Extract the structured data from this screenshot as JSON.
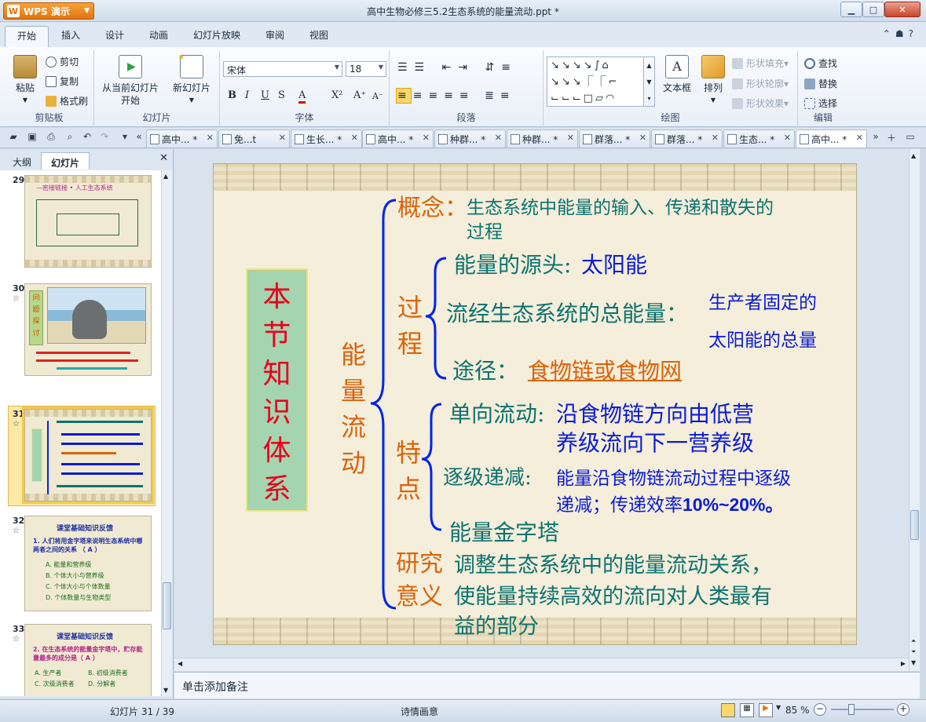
{
  "app": {
    "name": "WPS 演示",
    "window_title": "高中生物必修三5.2生态系统的能量流动.ppt *"
  },
  "ribbon_tabs": [
    "开始",
    "插入",
    "设计",
    "动画",
    "幻灯片放映",
    "审阅",
    "视图"
  ],
  "ribbon": {
    "clipboard": {
      "group": "剪贴板",
      "paste": "粘贴",
      "cut": "剪切",
      "copy": "复制",
      "format_painter": "格式刷"
    },
    "slides": {
      "group": "幻灯片",
      "from_current_1": "从当前幻灯片",
      "from_current_2": "开始",
      "new_slide": "新幻灯片"
    },
    "font": {
      "group": "字体",
      "name": "宋体",
      "size": "18"
    },
    "paragraph": {
      "group": "段落"
    },
    "drawing": {
      "group": "绘图",
      "textbox": "文本框",
      "arrange": "排列",
      "fill": "形状填充",
      "outline": "形状轮廓",
      "effects": "形状效果"
    },
    "editing": {
      "group": "编辑",
      "find": "查找",
      "replace": "替换",
      "select": "选择"
    }
  },
  "doc_tabs": [
    "高中... *",
    "免...t",
    "生长... *",
    "高中... *",
    "种群... *",
    "种群... *",
    "群落... *",
    "群落... *",
    "生态... *",
    "高中... *"
  ],
  "panel": {
    "tab_outline": "大纲",
    "tab_slides": "幻灯片"
  },
  "thumbnails": [
    {
      "num": "29",
      "title": "—密接链接 • 人工生态系统"
    },
    {
      "num": "30",
      "title": "问题探讨"
    },
    {
      "num": "31"
    },
    {
      "num": "32",
      "title": "课堂基础知识反馈",
      "q": "1. 人们将用金字塔来说明生态系统中哪两者之间的关系 （ A ）",
      "opts": [
        "A. 能量和营养级",
        "B. 个体大小与营养级",
        "C. 个体大小与个体数量",
        "D. 个体数量与生物类型"
      ]
    },
    {
      "num": "33",
      "title": "课堂基础知识反馈",
      "q": "2. 在生态系统的能量金字塔中，贮存能量最多的成分是（ A ）",
      "opts": [
        "A. 生产者",
        "B. 初级消费者",
        "C. 次级消费者",
        "D. 分解者"
      ]
    }
  ],
  "slide": {
    "title_vertical": [
      "本",
      "节",
      "知",
      "识",
      "体",
      "系"
    ],
    "root_vertical": [
      "能",
      "量",
      "流",
      "动"
    ],
    "concept": {
      "label": "概念",
      "colon": "：",
      "text_1": "生态系统中能量的输入、传递和散失的",
      "text_2": "过程"
    },
    "process": {
      "label_vertical": [
        "过",
        "程"
      ],
      "source_label": "能量的源头:",
      "source_value": "太阳能",
      "total_label": "流经生态系统的总能量：",
      "total_value_1": "生产者固定的",
      "total_value_2": "太阳能的总量",
      "path_label": "途径：",
      "path_value": "食物链或食物网"
    },
    "features": {
      "label_vertical": [
        "特",
        "点"
      ],
      "oneway_label": "单向流动:",
      "oneway_value_1": "沿食物链方向由低营",
      "oneway_value_2": "养级流向下一营养级",
      "decrease_label": "逐级递减:",
      "decrease_value_1": "能量沿食物链流动过程中逐级",
      "decrease_value_2": "递减；传递效率",
      "decrease_value_3": "10%~20%。",
      "pyramid": "能量金字塔"
    },
    "significance": {
      "label_1": "研究",
      "label_2": "意义",
      "text_1": "调整生态系统中的能量流动关系，",
      "text_2": "使能量持续高效的流向对人类最有",
      "text_3": "益的部分"
    }
  },
  "notes_placeholder": "单击添加备注",
  "status": {
    "slide_counter": "幻灯片 31 / 39",
    "theme": "诗情画意",
    "zoom": "85 %"
  },
  "colors": {
    "orange": "#d9630c",
    "teal": "#0d7270",
    "blue": "#0a1bd6",
    "red": "#e8001c",
    "bracket": "#0022ee"
  }
}
